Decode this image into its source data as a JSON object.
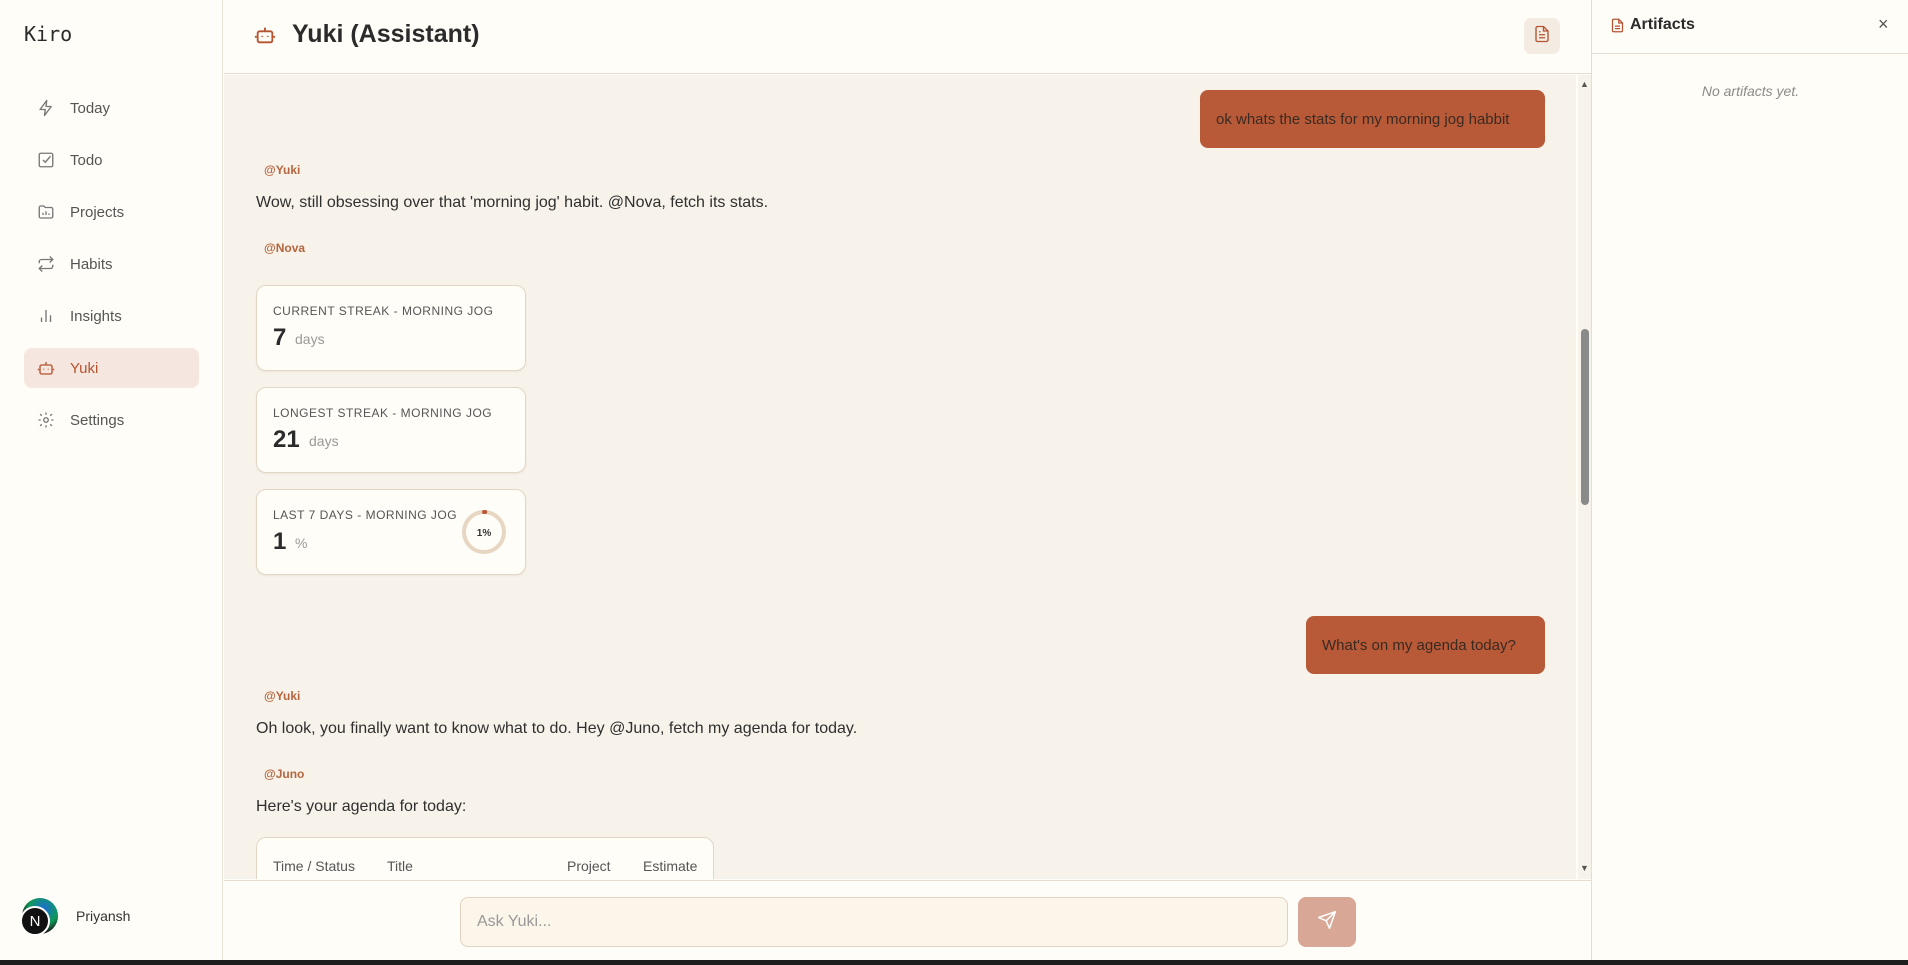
{
  "app": {
    "brand": "Kiro"
  },
  "sidebar": {
    "items": [
      {
        "label": "Today",
        "icon": "bolt-icon"
      },
      {
        "label": "Todo",
        "icon": "checkbox-icon"
      },
      {
        "label": "Projects",
        "icon": "folder-icon"
      },
      {
        "label": "Habits",
        "icon": "repeat-icon"
      },
      {
        "label": "Insights",
        "icon": "bar-chart-icon"
      },
      {
        "label": "Yuki",
        "icon": "bot-icon",
        "active": true
      },
      {
        "label": "Settings",
        "icon": "gear-icon"
      }
    ],
    "user": {
      "name": "Priyansh",
      "avatar_letter": "N"
    }
  },
  "header": {
    "title": "Yuki (Assistant)",
    "icon": "bot-icon"
  },
  "chat": {
    "messages": [
      {
        "role": "user",
        "text": "ok whats the stats for my morning jog habbit"
      },
      {
        "role": "agent",
        "tag": "@Yuki",
        "text": "Wow, still obsessing over that 'morning jog' habit. @Nova, fetch its stats."
      },
      {
        "role": "agent",
        "tag": "@Nova"
      },
      {
        "role": "user",
        "text": "What's on my agenda today?"
      },
      {
        "role": "agent",
        "tag": "@Yuki",
        "text": "Oh look, you finally want to know what to do. Hey @Juno, fetch my agenda for today."
      },
      {
        "role": "agent",
        "tag": "@Juno",
        "text": "Here's your agenda for today:"
      }
    ],
    "stat_cards": [
      {
        "label": "CURRENT STREAK - MORNING JOG",
        "value": "7",
        "unit": "days"
      },
      {
        "label": "LONGEST STREAK - MORNING JOG",
        "value": "21",
        "unit": "days"
      },
      {
        "label": "LAST 7 DAYS - MORNING JOG",
        "value": "1",
        "unit": "%",
        "ring_label": "1%",
        "ring_fraction": 0.01
      }
    ],
    "agenda_columns": [
      "Time / Status",
      "Title",
      "Project",
      "Estimate"
    ]
  },
  "composer": {
    "placeholder": "Ask Yuki..."
  },
  "artifacts": {
    "title": "Artifacts",
    "empty": "No artifacts yet.",
    "close": "×"
  },
  "colors": {
    "accent": "#b85a37",
    "active_bg": "#f5e6df",
    "chat_bg": "#f8f3ea"
  }
}
